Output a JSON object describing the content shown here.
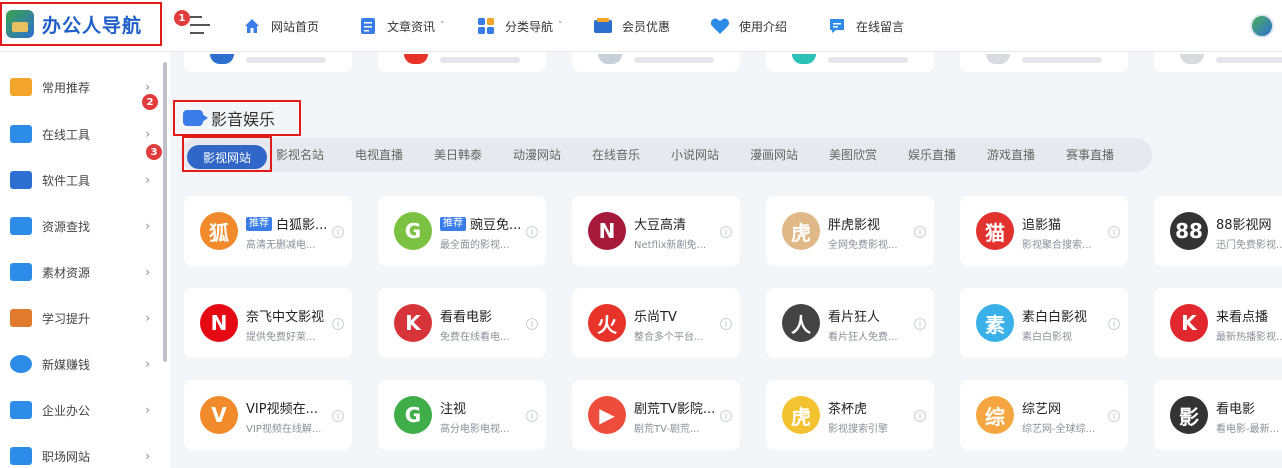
{
  "header": {
    "logo_text": "办公人导航",
    "badge_1": "1",
    "nav": [
      {
        "label": "网站首页",
        "icon": "home-icon",
        "caret": false
      },
      {
        "label": "文章资讯",
        "icon": "document-icon",
        "caret": true
      },
      {
        "label": "分类导航",
        "icon": "grid-icon",
        "caret": true
      },
      {
        "label": "会员优惠",
        "icon": "vip-icon",
        "caret": false
      },
      {
        "label": "使用介绍",
        "icon": "heart-icon",
        "caret": false
      },
      {
        "label": "在线留言",
        "icon": "message-icon",
        "caret": false
      }
    ]
  },
  "sidebar": {
    "items": [
      {
        "label": "常用推荐",
        "icon": "thumbs-up-icon",
        "color": "#f3a52b"
      },
      {
        "label": "在线工具",
        "icon": "toolbox-icon",
        "color": "#2d8ce8"
      },
      {
        "label": "软件工具",
        "icon": "monitor-icon",
        "color": "#2d6fd1"
      },
      {
        "label": "资源查找",
        "icon": "search-icon",
        "color": "#2d8ce8"
      },
      {
        "label": "素材资源",
        "icon": "image-icon",
        "color": "#2d8ce8"
      },
      {
        "label": "学习提升",
        "icon": "teacher-icon",
        "color": "#e07a2d"
      },
      {
        "label": "新媒赚钱",
        "icon": "pie-chart-icon",
        "color": "#2d8ce8"
      },
      {
        "label": "企业办公",
        "icon": "building-icon",
        "color": "#2d8ce8"
      },
      {
        "label": "职场网站",
        "icon": "person-icon",
        "color": "#2d8ce8"
      }
    ]
  },
  "section": {
    "badge_2": "2",
    "badge_3": "3",
    "title": "影音娱乐",
    "active_tab": "影视网站",
    "tabs": [
      "影视名站",
      "电视直播",
      "美日韩泰",
      "动漫网站",
      "在线音乐",
      "小说网站",
      "漫画网站",
      "美图欣赏",
      "娱乐直播",
      "游戏直播",
      "赛事直播"
    ]
  },
  "cards": [
    {
      "title": "白狐影...",
      "badge": "推荐",
      "desc": "高清无删减电...",
      "icon": "fox-icon",
      "color": "#f08a2b",
      "glyph": "狐"
    },
    {
      "title": "豌豆免...",
      "badge": "推荐",
      "desc": "最全面的影视...",
      "icon": "pea-icon",
      "color": "#7cc242",
      "glyph": "G"
    },
    {
      "title": "大豆高清",
      "badge": "",
      "desc": "Netflix新剧免...",
      "icon": "n-logo-icon",
      "color": "#a51a3a",
      "glyph": "N"
    },
    {
      "title": "胖虎影视",
      "badge": "",
      "desc": "全网免费影视...",
      "icon": "tiger-icon",
      "color": "#e0b888",
      "glyph": "虎"
    },
    {
      "title": "追影猫",
      "badge": "",
      "desc": "影视聚合搜索...",
      "icon": "cat-icon",
      "color": "#e2322e",
      "glyph": "猫"
    },
    {
      "title": "88影视网",
      "badge": "",
      "desc": "迅门免费影视...",
      "icon": "film-reel-icon",
      "color": "#333333",
      "glyph": "88"
    },
    {
      "title": "奈飞中文影视",
      "badge": "",
      "desc": "提供免费好莱...",
      "icon": "netflix-icon",
      "color": "#e50914",
      "glyph": "N"
    },
    {
      "title": "看看电影",
      "badge": "",
      "desc": "免费在线看电...",
      "icon": "kkdy-icon",
      "color": "#d7343a",
      "glyph": "K"
    },
    {
      "title": "乐尚TV",
      "badge": "",
      "desc": "整合多个平台...",
      "icon": "flame-icon",
      "color": "#e8332b",
      "glyph": "火"
    },
    {
      "title": "看片狂人",
      "badge": "",
      "desc": "看片狂人免费...",
      "icon": "cartoon-icon",
      "color": "#444444",
      "glyph": "人"
    },
    {
      "title": "素白白影视",
      "badge": "",
      "desc": "素白白影视",
      "icon": "subaibai-icon",
      "color": "#3ab0e8",
      "glyph": "素"
    },
    {
      "title": "来看点播",
      "badge": "",
      "desc": "最新热播影视...",
      "icon": "k-logo-icon",
      "color": "#e0282e",
      "glyph": "K"
    },
    {
      "title": "VIP视频在...",
      "badge": "",
      "desc": "VIP视频在线解...",
      "icon": "vip-video-icon",
      "color": "#f08a2b",
      "glyph": "V"
    },
    {
      "title": "注视",
      "badge": "",
      "desc": "高分电影电视...",
      "icon": "g-logo-icon",
      "color": "#3fae49",
      "glyph": "G"
    },
    {
      "title": "剧荒TV影院...",
      "badge": "",
      "desc": "剧荒TV-剧荒...",
      "icon": "play-icon",
      "color": "#ee4d3e",
      "glyph": "▶"
    },
    {
      "title": "茶杯虎",
      "badge": "",
      "desc": "影视搜索引擎",
      "icon": "cup-tiger-icon",
      "color": "#f2c230",
      "glyph": "虎"
    },
    {
      "title": "综艺网",
      "badge": "",
      "desc": "综艺网-全球综...",
      "icon": "zongyi-icon",
      "color": "#f5a640",
      "glyph": "综"
    },
    {
      "title": "看电影",
      "badge": "",
      "desc": "看电影-最新...",
      "icon": "film-camera-icon",
      "color": "#333333",
      "glyph": "影"
    }
  ]
}
